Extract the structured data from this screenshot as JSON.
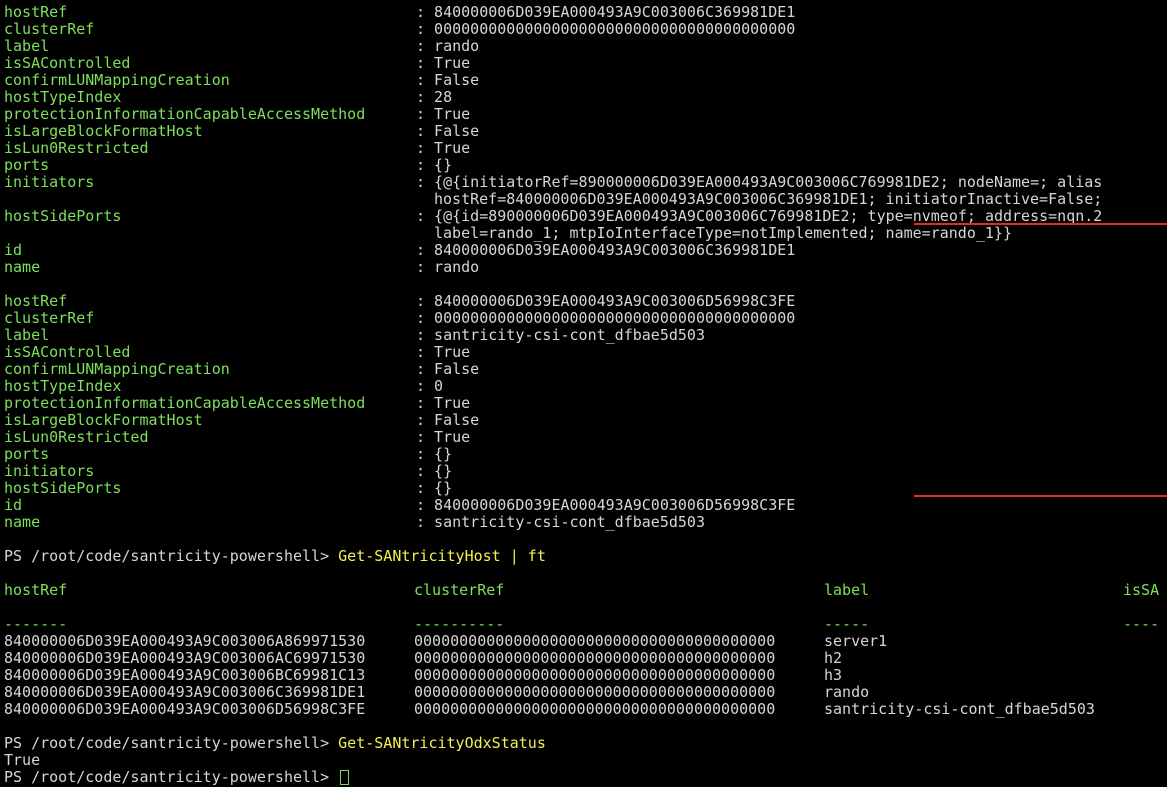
{
  "host1": {
    "rows": [
      {
        "key": "hostRef",
        "value": ": 840000006D039EA000493A9C003006C369981DE1"
      },
      {
        "key": "clusterRef",
        "value": ": 0000000000000000000000000000000000000000"
      },
      {
        "key": "label",
        "value": ": rando"
      },
      {
        "key": "isSAControlled",
        "value": ": True"
      },
      {
        "key": "confirmLUNMappingCreation",
        "value": ": False"
      },
      {
        "key": "hostTypeIndex",
        "value": ": 28"
      },
      {
        "key": "protectionInformationCapableAccessMethod",
        "value": ": True"
      },
      {
        "key": "isLargeBlockFormatHost",
        "value": ": False"
      },
      {
        "key": "isLun0Restricted",
        "value": ": True"
      },
      {
        "key": "ports",
        "value": ": {}"
      },
      {
        "key": "initiators",
        "value": ": {@{initiatorRef=890000006D039EA000493A9C003006C769981DE2; nodeName=; alias"
      },
      {
        "key": "",
        "value": "hostRef=840000006D039EA000493A9C003006C369981DE1; initiatorInactive=False;"
      },
      {
        "key": "hostSidePorts",
        "value": ": {@{id=890000006D039EA000493A9C003006C769981DE2; type=nvmeof; address=nqn.2"
      },
      {
        "key": "",
        "value": "label=rando_1; mtpIoInterfaceType=notImplemented; name=rando_1}}"
      },
      {
        "key": "id",
        "value": ": 840000006D039EA000493A9C003006C369981DE1"
      },
      {
        "key": "name",
        "value": ": rando"
      }
    ]
  },
  "host2": {
    "rows": [
      {
        "key": "hostRef",
        "value": ": 840000006D039EA000493A9C003006D56998C3FE"
      },
      {
        "key": "clusterRef",
        "value": ": 0000000000000000000000000000000000000000"
      },
      {
        "key": "label",
        "value": ": santricity-csi-cont_dfbae5d503"
      },
      {
        "key": "isSAControlled",
        "value": ": True"
      },
      {
        "key": "confirmLUNMappingCreation",
        "value": ": False"
      },
      {
        "key": "hostTypeIndex",
        "value": ": 0"
      },
      {
        "key": "protectionInformationCapableAccessMethod",
        "value": ": True"
      },
      {
        "key": "isLargeBlockFormatHost",
        "value": ": False"
      },
      {
        "key": "isLun0Restricted",
        "value": ": True"
      },
      {
        "key": "ports",
        "value": ": {}"
      },
      {
        "key": "initiators",
        "value": ": {}"
      },
      {
        "key": "hostSidePorts",
        "value": ": {}"
      },
      {
        "key": "id",
        "value": ": 840000006D039EA000493A9C003006D56998C3FE"
      },
      {
        "key": "name",
        "value": ": santricity-csi-cont_dfbae5d503"
      }
    ]
  },
  "command1": {
    "prompt": "PS /root/code/santricity-powershell> ",
    "cmd": "Get-SANtricityHost | ft"
  },
  "table": {
    "headers": [
      "hostRef",
      "clusterRef",
      "label",
      "isSA"
    ],
    "dashes": [
      "-------",
      "----------",
      "-----",
      "----"
    ],
    "rows": [
      [
        "840000006D039EA000493A9C003006A869971530",
        "0000000000000000000000000000000000000000",
        "server1"
      ],
      [
        "840000006D039EA000493A9C003006AC69971530",
        "0000000000000000000000000000000000000000",
        "h2"
      ],
      [
        "840000006D039EA000493A9C003006BC69981C13",
        "0000000000000000000000000000000000000000",
        "h3"
      ],
      [
        "840000006D039EA000493A9C003006C369981DE1",
        "0000000000000000000000000000000000000000",
        "rando"
      ],
      [
        "840000006D039EA000493A9C003006D56998C3FE",
        "0000000000000000000000000000000000000000",
        "santricity-csi-cont_dfbae5d503"
      ]
    ]
  },
  "command2": {
    "prompt": "PS /root/code/santricity-powershell> ",
    "cmd": "Get-SANtricityOdxStatus"
  },
  "output2": "True",
  "command3": {
    "prompt": "PS /root/code/santricity-powershell> ",
    "cmd": ""
  },
  "colors": {
    "key": "#7ce05a",
    "value": "#d6d6d6",
    "command": "#f1f152",
    "highlight": "#e02a2a",
    "background": "#000000"
  }
}
